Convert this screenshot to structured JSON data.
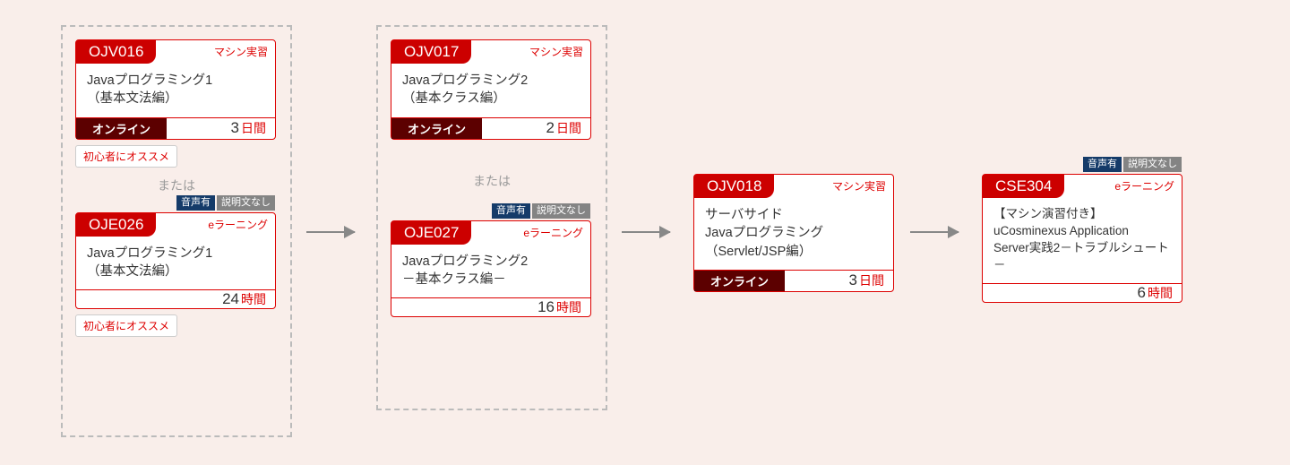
{
  "orLabel": "または",
  "chips": {
    "audio": "音声有",
    "noDesc": "説明文なし"
  },
  "group1": {
    "cardA": {
      "code": "OJV016",
      "tag": "マシン実習",
      "title1": "Javaプログラミング1",
      "title2": "（基本文法編）",
      "mode": "オンライン",
      "durNum": "3",
      "durUnit": "日間",
      "reco": "初心者にオススメ"
    },
    "cardB": {
      "code": "OJE026",
      "tag": "eラーニング",
      "title1": "Javaプログラミング1",
      "title2": "（基本文法編）",
      "durNum": "24",
      "durUnit": "時間",
      "reco": "初心者にオススメ"
    }
  },
  "group2": {
    "cardA": {
      "code": "OJV017",
      "tag": "マシン実習",
      "title1": "Javaプログラミング2",
      "title2": "（基本クラス編）",
      "mode": "オンライン",
      "durNum": "2",
      "durUnit": "日間"
    },
    "cardB": {
      "code": "OJE027",
      "tag": "eラーニング",
      "title1": "Javaプログラミング2",
      "title2": "－基本クラス編－",
      "durNum": "16",
      "durUnit": "時間"
    }
  },
  "card3": {
    "code": "OJV018",
    "tag": "マシン実習",
    "title1": "サーバサイド",
    "title2": "Javaプログラミング",
    "title3": "（Servlet/JSP編）",
    "mode": "オンライン",
    "durNum": "3",
    "durUnit": "日間"
  },
  "card4": {
    "code": "CSE304",
    "tag": "eラーニング",
    "title1": "【マシン演習付き】",
    "title2": "uCosminexus Application",
    "title3": "Server実践2－トラブルシュート－",
    "durNum": "6",
    "durUnit": "時間"
  }
}
